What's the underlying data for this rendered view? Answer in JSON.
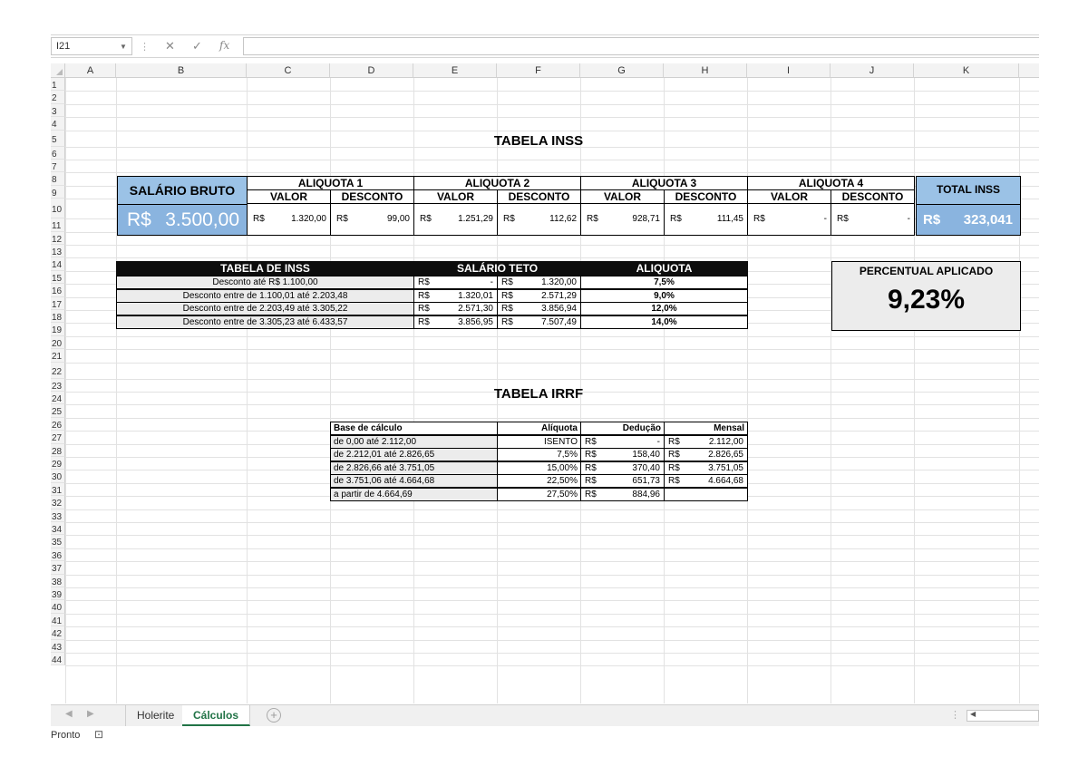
{
  "formula_bar": {
    "cell_ref": "I21",
    "fx": "fx",
    "cancel": "✕",
    "confirm": "✓",
    "content": ""
  },
  "columns": [
    "A",
    "B",
    "C",
    "D",
    "E",
    "F",
    "G",
    "H",
    "I",
    "J",
    "K"
  ],
  "rows": [
    "1",
    "2",
    "3",
    "4",
    "5",
    "6",
    "7",
    "8",
    "9",
    "10",
    "11",
    "12",
    "13",
    "14",
    "15",
    "16",
    "17",
    "18",
    "19",
    "20",
    "21",
    "22",
    "23",
    "24",
    "25",
    "26",
    "27",
    "28",
    "29",
    "30",
    "31",
    "32",
    "33",
    "34",
    "35",
    "36",
    "37",
    "38",
    "39",
    "40",
    "41",
    "42",
    "43",
    "44"
  ],
  "inss_title": "TABELA INSS",
  "salary": {
    "label": "SALÁRIO BRUTO",
    "currency": "R$",
    "value": "3.500,00"
  },
  "aliquotas": [
    {
      "name": "ALIQUOTA 1",
      "valor_label": "VALOR",
      "desconto_label": "DESCONTO",
      "valor": "1.320,00",
      "desconto": "99,00"
    },
    {
      "name": "ALIQUOTA 2",
      "valor_label": "VALOR",
      "desconto_label": "DESCONTO",
      "valor": "1.251,29",
      "desconto": "112,62"
    },
    {
      "name": "ALIQUOTA 3",
      "valor_label": "VALOR",
      "desconto_label": "DESCONTO",
      "valor": "928,71",
      "desconto": "111,45"
    },
    {
      "name": "ALIQUOTA 4",
      "valor_label": "VALOR",
      "desconto_label": "DESCONTO",
      "valor": "-",
      "desconto": "-"
    }
  ],
  "currency": "R$",
  "total_inss": {
    "label": "TOTAL INSS",
    "currency": "R$",
    "value": "323,041"
  },
  "inss_table": {
    "headers": [
      "TABELA DE INSS",
      "SALÁRIO TETO",
      "ALIQUOTA"
    ],
    "rows": [
      {
        "desc": "Desconto até R$ 1.100,00",
        "min": "-",
        "max": "1.320,00",
        "rate": "7,5%"
      },
      {
        "desc": "Desconto entre de 1.100,01 até 2.203,48",
        "min": "1.320,01",
        "max": "2.571,29",
        "rate": "9,0%"
      },
      {
        "desc": "Desconto entre de 2.203,49 até 3.305,22",
        "min": "2.571,30",
        "max": "3.856,94",
        "rate": "12,0%"
      },
      {
        "desc": "Desconto entre de 3.305,23 até 6.433,57",
        "min": "3.856,95",
        "max": "7.507,49",
        "rate": "14,0%"
      }
    ]
  },
  "percentual": {
    "label": "PERCENTUAL APLICADO",
    "value": "9,23%"
  },
  "irrf_title": "TABELA IRRF",
  "irrf_table": {
    "headers": [
      "Base de cálculo",
      "Alíquota",
      "Dedução",
      "Mensal"
    ],
    "rows": [
      {
        "base": "de 0,00 até 2.112,00",
        "rate": "ISENTO",
        "ded": "-",
        "mensal": "2.112,00"
      },
      {
        "base": "de 2.212,01 até 2.826,65",
        "rate": "7,5%",
        "ded": "158,40",
        "mensal": "2.826,65"
      },
      {
        "base": "de 2.826,66 até 3.751,05",
        "rate": "15,00%",
        "ded": "370,40",
        "mensal": "3.751,05"
      },
      {
        "base": "de 3.751,06 até 4.664,68",
        "rate": "22,50%",
        "ded": "651,73",
        "mensal": "4.664,68"
      },
      {
        "base": "a partir de 4.664,69",
        "rate": "27,50%",
        "ded": "884,96",
        "mensal": ""
      }
    ]
  },
  "sheet_tabs": [
    {
      "label": "Holerite",
      "active": false
    },
    {
      "label": "Cálculos",
      "active": true
    }
  ],
  "add_sheet": "+",
  "status": "Pronto",
  "nav_left": "◀",
  "nav_right": "▶"
}
